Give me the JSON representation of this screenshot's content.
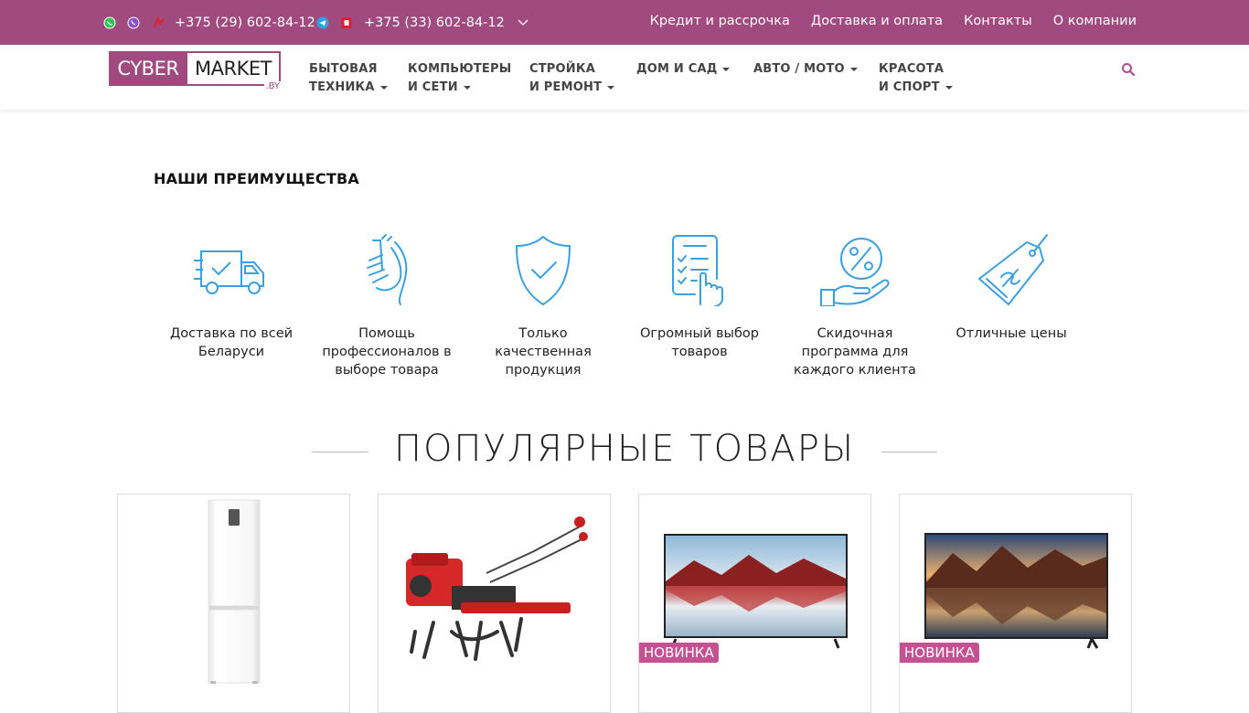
{
  "topbar": {
    "phone1": "+375 (29) 602-84-12",
    "phone2": "+375 (33) 602-84-12",
    "links": [
      "Кредит и рассрочка",
      "Доставка и оплата",
      "Контакты",
      "О компании"
    ]
  },
  "logo": {
    "left": "CYBER",
    "right": "MARKET",
    "tld": ".BY"
  },
  "nav": [
    {
      "line1": "Бытовая",
      "line2": "техника"
    },
    {
      "line1": "Компьютеры",
      "line2": "и сети"
    },
    {
      "line1": "Стройка",
      "line2": "и ремонт"
    },
    {
      "line1": "Дом и сад",
      "line2": ""
    },
    {
      "line1": "Авто / Мото",
      "line2": ""
    },
    {
      "line1": "Красота",
      "line2": "и спорт"
    }
  ],
  "advantages": {
    "title": "НАШИ ПРЕИМУЩЕСТВА",
    "items": [
      {
        "label": "Доставка по всей Беларуси",
        "icon": "delivery-truck-icon"
      },
      {
        "label": "Помощь профессионалов в выборе товара",
        "icon": "handshake-icon"
      },
      {
        "label": "Только качественная продукция",
        "icon": "quality-shield-icon"
      },
      {
        "label": "Огромный выбор товаров",
        "icon": "checklist-icon"
      },
      {
        "label": "Скидочная программа для каждого клиента",
        "icon": "discount-hand-icon"
      },
      {
        "label": "Отличные цены",
        "icon": "price-tag-icon"
      }
    ]
  },
  "popular": {
    "title": "ПОПУЛЯРНЫЕ ТОВАРЫ",
    "badge": "НОВИНКА"
  },
  "colors": {
    "brand": "#a04a80",
    "accent_icon": "#3aa0e0",
    "badge": "#c45191"
  }
}
